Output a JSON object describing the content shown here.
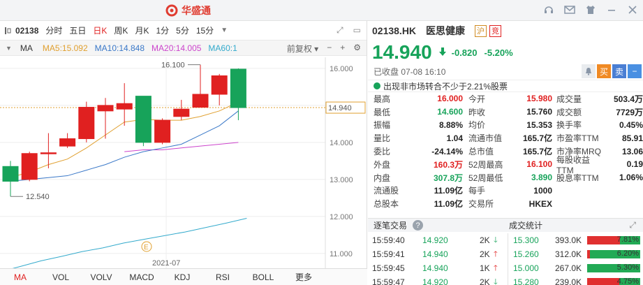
{
  "app": {
    "name": "华盛通",
    "window_icons": [
      "headset-icon",
      "mail-icon",
      "shirt-icon",
      "minimize-icon",
      "close-icon"
    ]
  },
  "chart_toolbar": {
    "code": "02138",
    "periods": [
      "分时",
      "五日",
      "日K",
      "周K",
      "月K",
      "1分",
      "5分",
      "15分"
    ],
    "active_period": "日K"
  },
  "ma_bar": {
    "label": "MA",
    "ma5": "MA5:15.092",
    "ma10": "MA10:14.848",
    "ma20": "MA20:14.005",
    "ma60": "MA60:1",
    "adjust": "前复权",
    "colors": {
      "ma5": "#e0a030",
      "ma10": "#3a78c8",
      "ma20": "#cc44cc",
      "ma60": "#33aacc"
    }
  },
  "chart_data": {
    "type": "candlestick",
    "y_ticks": [
      "16.000",
      "15.000",
      "14.000",
      "13.000",
      "12.000",
      "11.000"
    ],
    "ylim": [
      10.6,
      16.3
    ],
    "x_label": "2021-07",
    "high_label": "16.100",
    "low_label": "12.540",
    "current_label": "14.940",
    "event_marker": "E",
    "candles": [
      {
        "o": 13.35,
        "c": 12.95,
        "h": 13.5,
        "l": 12.54
      },
      {
        "o": 13.0,
        "c": 13.7,
        "h": 13.75,
        "l": 12.95
      },
      {
        "o": 13.7,
        "c": 13.72,
        "h": 14.25,
        "l": 13.3
      },
      {
        "o": 13.9,
        "c": 14.1,
        "h": 14.25,
        "l": 13.85
      },
      {
        "o": 14.1,
        "c": 14.95,
        "h": 15.1,
        "l": 14.0
      },
      {
        "o": 14.85,
        "c": 15.0,
        "h": 15.2,
        "l": 14.1
      },
      {
        "o": 14.9,
        "c": 15.05,
        "h": 15.6,
        "l": 14.45
      },
      {
        "o": 15.25,
        "c": 14.0,
        "h": 15.25,
        "l": 13.9
      },
      {
        "o": 14.0,
        "c": 14.6,
        "h": 14.65,
        "l": 13.95
      },
      {
        "o": 14.7,
        "c": 14.9,
        "h": 15.15,
        "l": 14.6
      },
      {
        "o": 14.95,
        "c": 15.3,
        "h": 16.1,
        "l": 14.95
      },
      {
        "o": 15.3,
        "c": 15.8,
        "h": 15.85,
        "l": 15.0
      },
      {
        "o": 15.98,
        "c": 14.94,
        "h": 16.0,
        "l": 14.6
      }
    ],
    "ma5": [
      13.05,
      13.2,
      13.4,
      13.55,
      13.85,
      14.2,
      14.55,
      14.62,
      14.6,
      14.6,
      14.7,
      14.85,
      15.09
    ],
    "ma10": [
      12.95,
      13.0,
      13.05,
      13.1,
      13.25,
      13.4,
      13.6,
      13.75,
      13.85,
      13.95,
      14.2,
      14.45,
      14.85
    ],
    "ma20": [
      null,
      null,
      null,
      null,
      null,
      null,
      13.75,
      13.8,
      13.8,
      13.85,
      13.9,
      13.95,
      14.0
    ],
    "ma60": [
      10.5,
      10.65,
      10.8,
      10.92,
      11.05,
      11.15,
      11.28,
      11.38,
      11.48,
      11.58,
      11.7,
      11.82,
      11.95
    ]
  },
  "indicators": [
    "MA",
    "VOL",
    "VOLV",
    "MACD",
    "KDJ",
    "RSI",
    "BOLL",
    "更多"
  ],
  "active_indicator": "MA",
  "quote": {
    "code": "02138.HK",
    "name": "医思健康",
    "badge1": "沪",
    "badge2": "竞",
    "price": "14.940",
    "change": "-0.820",
    "change_pct": "-5.20%",
    "status": "已收盘 07-08 16:10",
    "buy_label": "买",
    "sell_label": "卖",
    "minus_label": "−",
    "notice": "出现非市场转合不少于2.21%股票",
    "fields": [
      [
        "最高",
        "16.000",
        "red",
        "今开",
        "15.980",
        "red",
        "成交量",
        "503.4万",
        "blk"
      ],
      [
        "最低",
        "14.600",
        "green",
        "昨收",
        "15.760",
        "blk",
        "成交额",
        "7729万",
        "blk"
      ],
      [
        "振幅",
        "8.88%",
        "blk",
        "均价",
        "15.353",
        "blk",
        "换手率",
        "0.45%",
        "blk"
      ],
      [
        "量比",
        "1.04",
        "blk",
        "流通市值",
        "165.7亿",
        "blk",
        "市盈率TTM",
        "85.91",
        "blk"
      ],
      [
        "委比",
        "-24.14%",
        "blk",
        "总市值",
        "165.7亿",
        "blk",
        "市净率MRQ",
        "13.06",
        "blk"
      ],
      [
        "外盘",
        "160.3万",
        "red",
        "52周最高",
        "16.100",
        "red",
        "每股收益TTM",
        "0.19",
        "blk"
      ],
      [
        "内盘",
        "307.8万",
        "green",
        "52周最低",
        "3.890",
        "green",
        "股息率TTM",
        "1.06%",
        "blk"
      ],
      [
        "流通股",
        "11.09亿",
        "blk",
        "每手",
        "1000",
        "blk",
        "",
        "",
        "blk"
      ],
      [
        "总股本",
        "11.09亿",
        "blk",
        "交易所",
        "HKEX",
        "blk",
        "",
        "",
        "blk"
      ]
    ]
  },
  "ticks_header": {
    "left": "逐笔交易",
    "right": "成交统计",
    "help": "?"
  },
  "ticks": [
    {
      "time": "15:59:40",
      "price": "14.920",
      "vol": "2K",
      "dir": "down"
    },
    {
      "time": "15:59:41",
      "price": "14.940",
      "vol": "2K",
      "dir": "up"
    },
    {
      "time": "15:59:45",
      "price": "14.940",
      "vol": "1K",
      "dir": "up"
    },
    {
      "time": "15:59:47",
      "price": "14.920",
      "vol": "2K",
      "dir": "down"
    }
  ],
  "stats": [
    {
      "price": "15.300",
      "vol": "393.0K",
      "pct": "7.81%",
      "red": 0.62,
      "green": 0.38
    },
    {
      "price": "15.260",
      "vol": "312.0K",
      "pct": "6.20%",
      "red": 0.05,
      "green": 0.95
    },
    {
      "price": "15.000",
      "vol": "267.0K",
      "pct": "5.30%",
      "red": 0.0,
      "green": 1.0
    },
    {
      "price": "15.280",
      "vol": "239.0K",
      "pct": "4.75%",
      "red": 0.6,
      "green": 0.4
    }
  ]
}
